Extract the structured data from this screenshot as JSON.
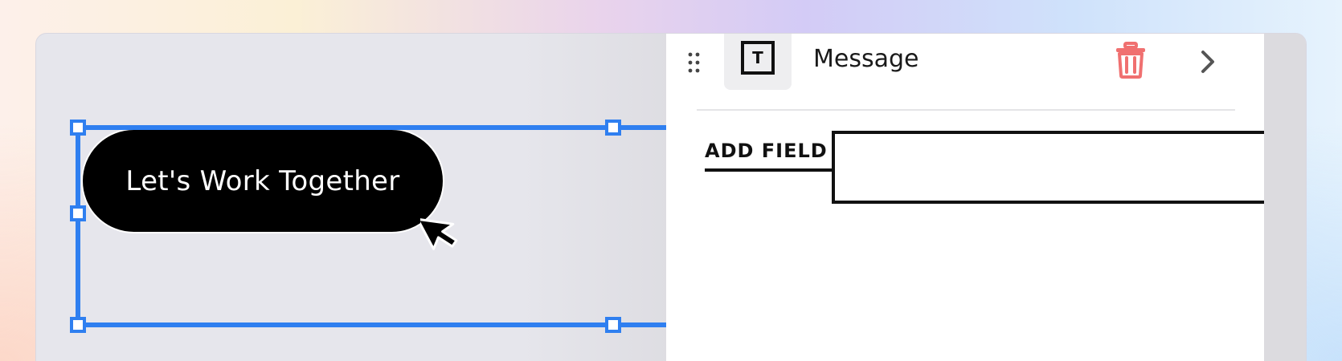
{
  "canvas": {
    "button_label": "Let's Work Together"
  },
  "panel": {
    "field_type_icon_glyph": "T",
    "field_title": "Message",
    "add_field_label": "ADD FIELD",
    "field_input_value": ""
  },
  "icons": {
    "drag": "drag-handle-icon",
    "text_type": "text-field-icon",
    "delete": "trash-icon",
    "expand": "chevron-right-icon",
    "cursor": "mouse-cursor-icon"
  },
  "colors": {
    "selection": "#2f7ff0",
    "delete": "#f07070",
    "button_bg": "#000000"
  }
}
